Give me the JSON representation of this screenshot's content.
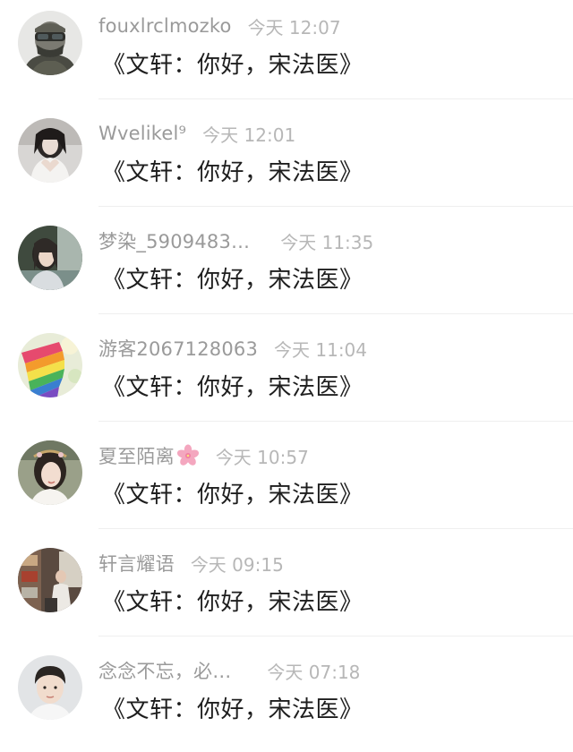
{
  "comments": [
    {
      "username": "fouxlrclmozko",
      "time": "今天 12:07",
      "content": "《文轩：你好，宋法医》",
      "avatar": "masked-soldier-avatar"
    },
    {
      "username": "Wvelikel⁹",
      "time": "今天 12:01",
      "content": "《文轩：你好，宋法医》",
      "avatar": "girl-heart-hands-avatar"
    },
    {
      "username": "梦染_5909483…",
      "time": "今天 11:35",
      "content": "《文轩：你好，宋法医》",
      "avatar": "girl-portrait-avatar"
    },
    {
      "username": "游客2067128063",
      "time": "今天 11:04",
      "content": "《文轩：你好，宋法医》",
      "avatar": "rainbow-cake-avatar"
    },
    {
      "username": "夏至陌离",
      "time": "今天 10:57",
      "content": "《文轩：你好，宋法医》",
      "avatar": "smiling-girl-avatar",
      "badge_icon": "cherry-blossom-icon"
    },
    {
      "username": "轩言耀语",
      "time": "今天 09:15",
      "content": "《文轩：你好，宋法医》",
      "avatar": "street-scene-avatar"
    },
    {
      "username": "念念不忘，必…",
      "time": "今天 07:18",
      "content": "《文轩：你好，宋法医》",
      "avatar": "young-man-avatar"
    }
  ]
}
